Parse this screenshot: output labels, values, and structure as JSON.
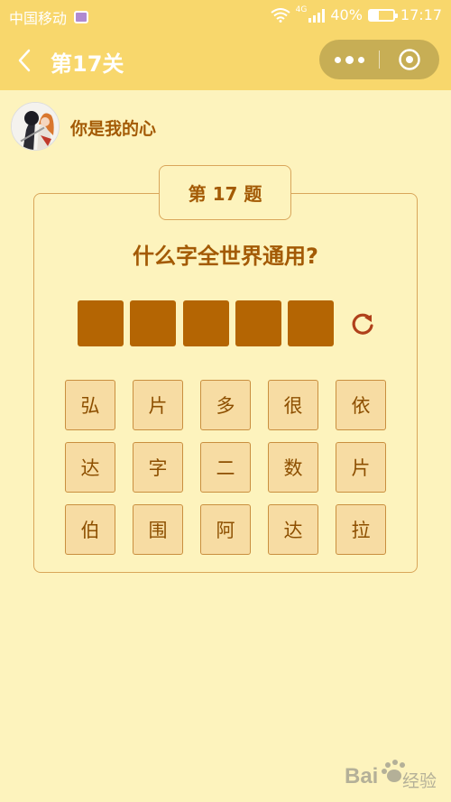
{
  "status_bar": {
    "carrier": "中国移动",
    "network": "4G",
    "battery": "40%",
    "battery_level": 0.4,
    "time": "17:17"
  },
  "header": {
    "title": "第17关"
  },
  "user": {
    "name": "你是我的心"
  },
  "puzzle": {
    "level_label": "第 17 题",
    "question": "什么字全世界通用?",
    "answer_slots": [
      "",
      "",
      "",
      "",
      ""
    ],
    "candidates": [
      [
        "弘",
        "片",
        "多",
        "很",
        "依"
      ],
      [
        "达",
        "字",
        "二",
        "数",
        "片"
      ],
      [
        "伯",
        "围",
        "阿",
        "达",
        "拉"
      ]
    ]
  },
  "colors": {
    "background": "#fdf3bd",
    "header": "#f8d76c",
    "accent_text": "#a35a05",
    "answer_slot": "#b46503",
    "tile": "#f7dca3"
  },
  "watermark": {
    "text": "Bai经验"
  }
}
